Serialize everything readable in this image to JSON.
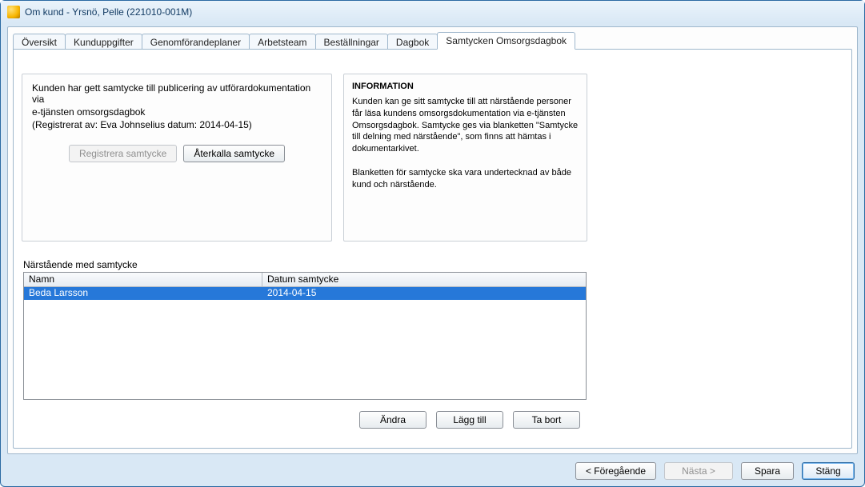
{
  "window": {
    "title": "Om kund - Yrsnö, Pelle (221010-001M)"
  },
  "tabs": [
    {
      "label": "Översikt"
    },
    {
      "label": "Kunduppgifter"
    },
    {
      "label": "Genomförandeplaner"
    },
    {
      "label": "Arbetsteam"
    },
    {
      "label": "Beställningar"
    },
    {
      "label": "Dagbok"
    },
    {
      "label": "Samtycken Omsorgsdagbok",
      "active": true
    }
  ],
  "consent": {
    "line1": "Kunden har gett samtycke till publicering av utförardokumentation via",
    "line2": "e-tjänsten omsorgsdagbok",
    "line3": "(Registrerat av: Eva Johnselius datum: 2014-04-15)",
    "register_label": "Registrera samtycke",
    "revoke_label": "Återkalla samtycke"
  },
  "info": {
    "heading": "INFORMATION",
    "p1": "Kunden kan ge sitt samtycke till att närstående personer får läsa kundens omsorgsdokumentation via e-tjänsten Omsorgsdagbok. Samtycke ges via blanketten \"Samtycke till delning med närstående\", som finns att hämtas i dokumentarkivet.",
    "p2": "Blanketten för samtycke ska vara undertecknad av både kund och närstående."
  },
  "relatives": {
    "section_label": "Närstående med samtycke",
    "columns": {
      "name": "Namn",
      "date": "Datum samtycke"
    },
    "rows": [
      {
        "name": "Beda  Larsson",
        "date": "2014-04-15",
        "selected": true
      }
    ],
    "edit_label": "Ändra",
    "add_label": "Lägg till",
    "remove_label": "Ta bort"
  },
  "footer": {
    "prev": "< Föregående",
    "next": "Nästa >",
    "save": "Spara",
    "close": "Stäng"
  }
}
